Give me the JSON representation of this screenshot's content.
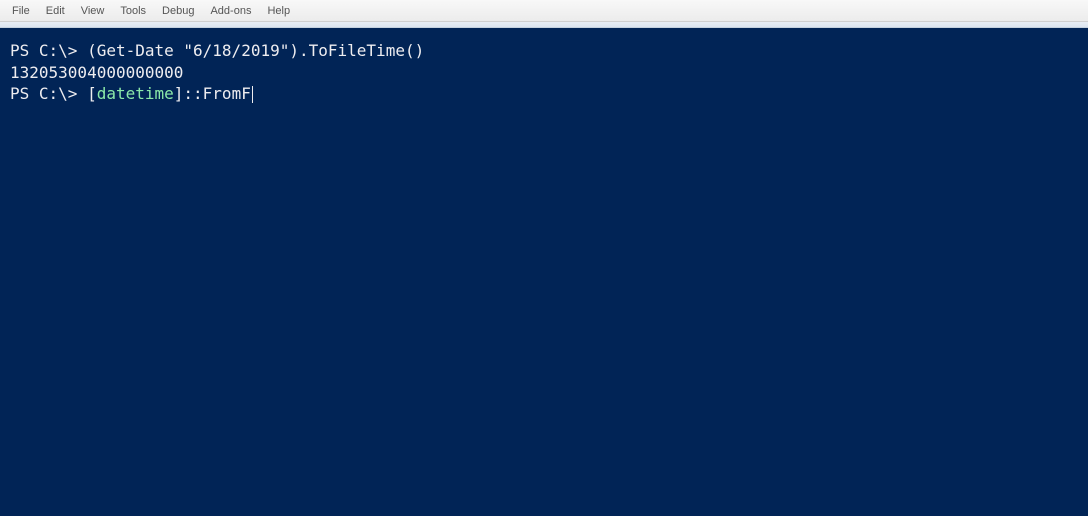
{
  "menu": {
    "items": [
      "File",
      "Edit",
      "View",
      "Tools",
      "Debug",
      "Add-ons",
      "Help"
    ]
  },
  "terminal": {
    "lines": [
      {
        "segments": [
          {
            "text": "PS C:\\> ",
            "cls": "prompt"
          },
          {
            "text": "(Get-Date ",
            "cls": "cmd-text"
          },
          {
            "text": "\"6/18/2019\"",
            "cls": "string"
          },
          {
            "text": ").ToFileTime()",
            "cls": "cmd-text"
          }
        ]
      },
      {
        "segments": [
          {
            "text": "132053004000000000",
            "cls": "cmd-text"
          }
        ]
      },
      {
        "segments": [
          {
            "text": "",
            "cls": "cmd-text"
          }
        ]
      },
      {
        "segments": [
          {
            "text": "PS C:\\> ",
            "cls": "prompt"
          },
          {
            "text": "[",
            "cls": "cmd-text"
          },
          {
            "text": "datetime",
            "cls": "type-name"
          },
          {
            "text": "]::FromF",
            "cls": "cmd-text"
          }
        ],
        "cursor": true
      }
    ],
    "current_input": "[datetime]::FromF"
  }
}
